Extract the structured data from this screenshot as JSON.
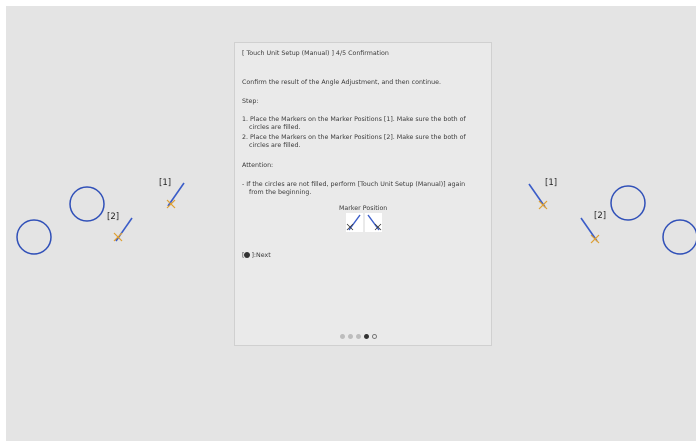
{
  "dialog": {
    "title": "[ Touch Unit Setup (Manual) ]  4/5 Confirmation",
    "intro": "Confirm the result of the Angle Adjustment, and then continue.",
    "step_heading": "Step:",
    "steps": [
      "1. Place the Markers on the Marker Positions [1]. Make sure the both of circles are filled.",
      "2. Place the Markers on the Marker Positions [2]. Make sure the both of circles are filled."
    ],
    "attention_heading": "Attention:",
    "attention_text": "- If the circles are not filled, perform [Touch Unit Setup (Manual)] again from the beginning.",
    "marker_position_label": "Marker Position",
    "next_label": "]:Next",
    "next_bracket": "[",
    "progress": {
      "current": 4,
      "total": 5
    }
  },
  "markers": {
    "left_label_1": "[1]",
    "left_label_2": "[2]",
    "right_label_1": "[1]",
    "right_label_2": "[2]"
  },
  "colors": {
    "screen_bg": "#e4e4e4",
    "dialog_bg": "#eaeaea",
    "circle_stroke": "#3050b8",
    "marker_line": "#3a5cc8",
    "marker_cross": "#e0a030"
  },
  "icons": {
    "next": "check-circle-icon"
  }
}
